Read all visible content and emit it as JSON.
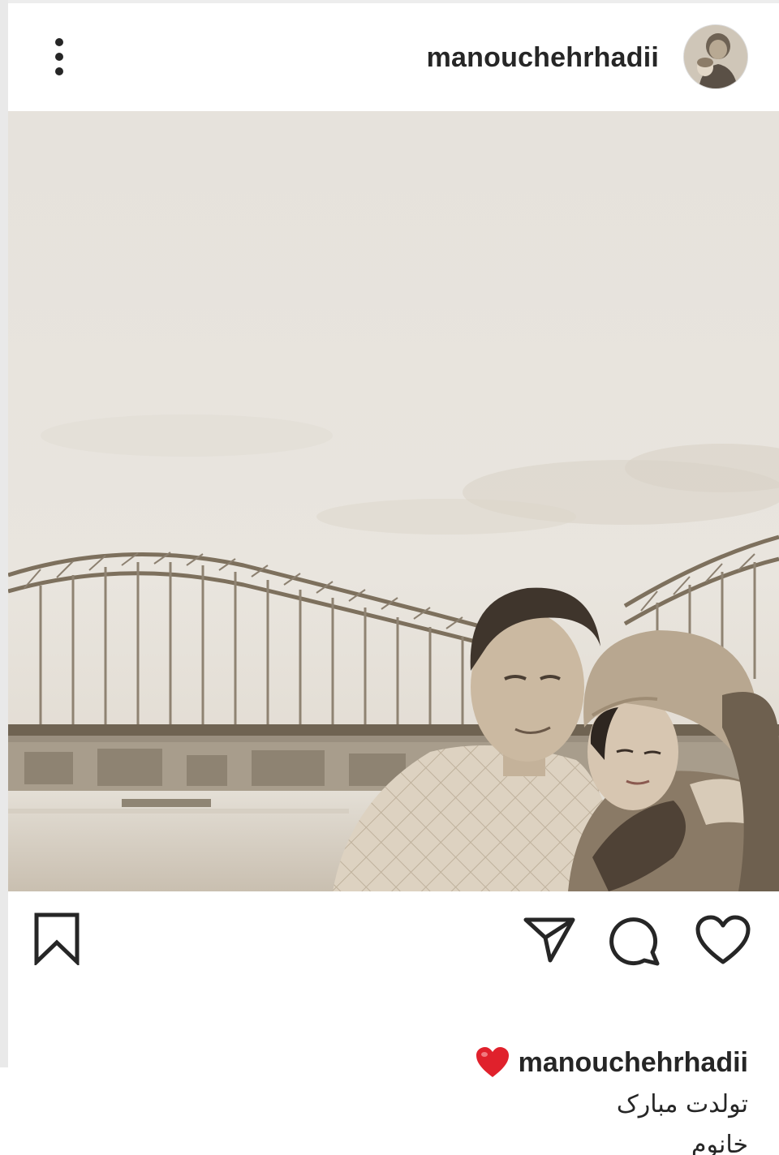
{
  "post": {
    "username": "manouchehrhadii",
    "more_icon": "more-vertical-icon",
    "avatar_icon": "profile-avatar"
  },
  "photo": {
    "description_icon": "post-photo"
  },
  "actions": {
    "save_icon": "bookmark-icon",
    "share_icon": "send-icon",
    "comment_icon": "comment-icon",
    "like_icon": "heart-outline-icon"
  },
  "caption": {
    "emoji": "❤️",
    "username": "manouchehrhadii",
    "lines": [
      "تولدت مبارک",
      "خانوم"
    ]
  },
  "colors": {
    "text": "#262626",
    "heart_emoji": "#e0212c",
    "sepia": "#8a7c68"
  }
}
